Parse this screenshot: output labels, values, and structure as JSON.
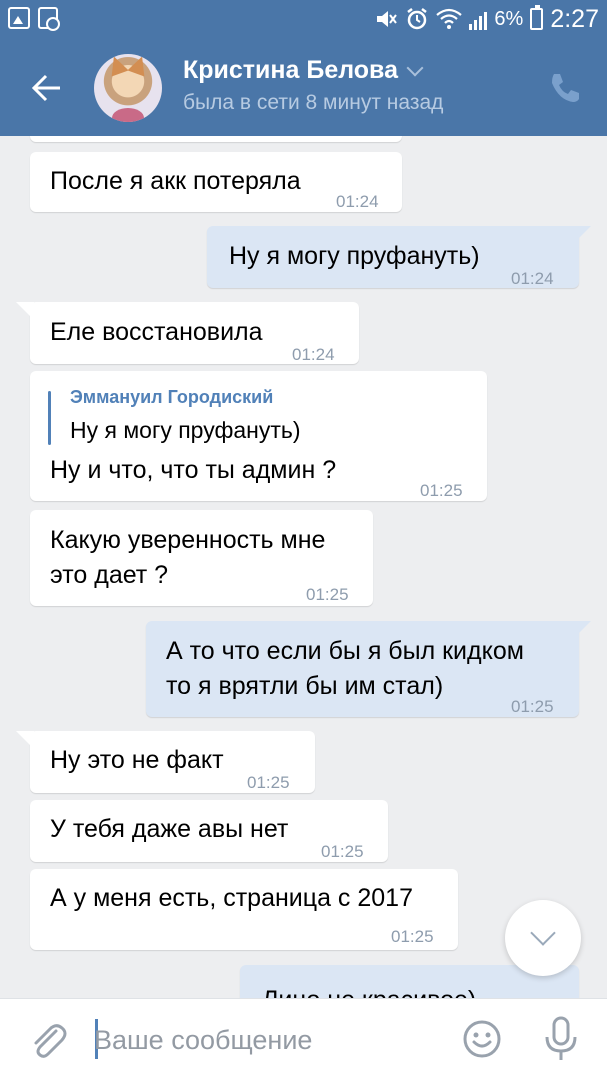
{
  "status_bar": {
    "battery": "6%",
    "time": "2:27"
  },
  "header": {
    "contact_name": "Кристина Белова",
    "contact_status": "была в сети 8 минут назад"
  },
  "messages": [
    {
      "direction": "in",
      "text": "После я акк потеряла",
      "time": "01:24"
    },
    {
      "direction": "out",
      "text": "Ну я могу пруфануть)",
      "time": "01:24"
    },
    {
      "direction": "in",
      "text": "Еле восстановила",
      "time": "01:24"
    },
    {
      "direction": "in",
      "reply_author": "Эммануил Городиский",
      "reply_text": "Ну я могу пруфануть)",
      "text": "Ну и что, что ты админ ?",
      "time": "01:25"
    },
    {
      "direction": "in",
      "lines": [
        "Какую уверенность мне",
        "это дает ?"
      ],
      "time": "01:25"
    },
    {
      "direction": "out",
      "lines": [
        "А то что если бы я был кидком",
        "то я врятли бы им стал)"
      ],
      "time": "01:25"
    },
    {
      "direction": "in",
      "text": "Ну это не факт",
      "time": "01:25"
    },
    {
      "direction": "in",
      "text": "У тебя даже авы нет",
      "time": "01:25"
    },
    {
      "direction": "in",
      "text": "А у меня есть, страница с 2017",
      "time": "01:25"
    },
    {
      "direction": "out",
      "text": "Лицо не красивое)",
      "time": ""
    }
  ],
  "composer": {
    "placeholder": "Ваше сообщение"
  },
  "icons": {
    "back": "arrow-left-icon",
    "call": "phone-icon",
    "attach": "paperclip-icon",
    "emoji": "smiley-icon",
    "mic": "microphone-icon",
    "scroll": "chevron-down-icon"
  },
  "colors": {
    "header": "#4a76a8",
    "background": "#edeef0",
    "incoming_bubble": "#ffffff",
    "outgoing_bubble": "#dbe6f4",
    "accent": "#5181b8",
    "time_text": "#8e9cad"
  }
}
